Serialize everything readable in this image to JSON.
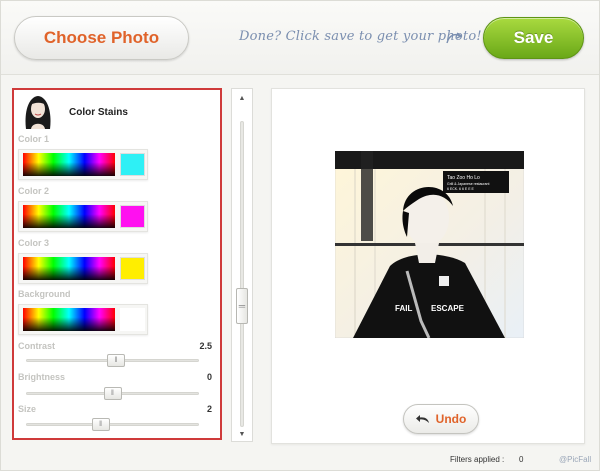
{
  "header": {
    "choose_label": "Choose Photo",
    "hint": "Done? Click save to get your photo!",
    "save_label": "Save"
  },
  "filter": {
    "name": "Color Stains",
    "colors": [
      {
        "label": "Color 1",
        "value": "#2ef0f5"
      },
      {
        "label": "Color 2",
        "value": "#ff10f0"
      },
      {
        "label": "Color 3",
        "value": "#ffee00"
      }
    ],
    "background": {
      "label": "Background",
      "value": "#ffffff"
    },
    "sliders": [
      {
        "label": "Contrast",
        "value": "2.5",
        "level": 0.52
      },
      {
        "label": "Brightness",
        "value": "0",
        "level": 0.5
      },
      {
        "label": "Size",
        "value": "2",
        "level": 0.43
      }
    ]
  },
  "preview": {
    "undo_label": "Undo",
    "sign_text": [
      "Tao Zoo Ho Lo",
      "Grill & Japanese restaurant",
      "6 ECK. 6 6 E E E"
    ],
    "tshirt_text": [
      "FAIL",
      "ESCAPE"
    ]
  },
  "footer": {
    "filters_label": "Filters applied :",
    "filters_count": "0",
    "brand": "@PicFall"
  },
  "scroll": {
    "position": 0.55
  }
}
